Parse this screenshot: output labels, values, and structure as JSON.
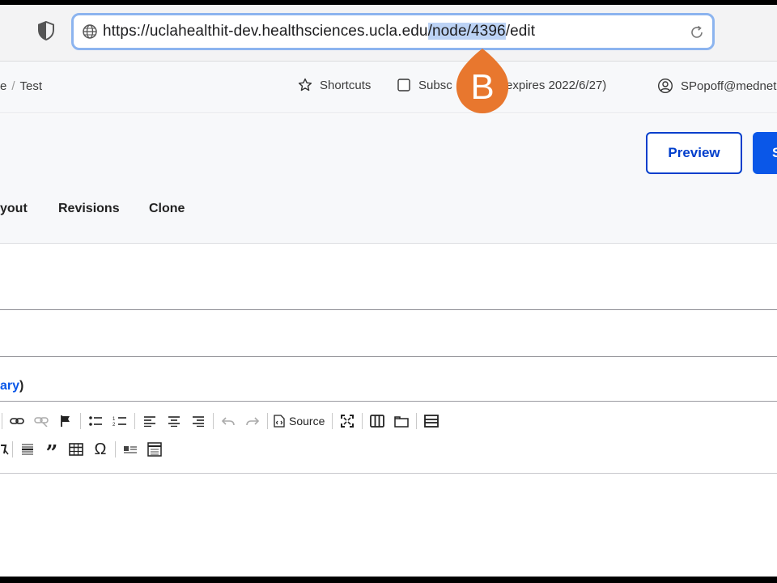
{
  "browser": {
    "url_prefix": "https://uclahealthit-dev.healthsciences.ucla.edu",
    "url_selected": "/node/4396",
    "url_suffix": "/edit"
  },
  "admin_toolbar": {
    "breadcrumb_prev": "e",
    "breadcrumb_current": "Test",
    "shortcuts_label": "Shortcuts",
    "subscribe_label_start": "Subsc",
    "subscribe_label_end": "ive (expires 2022/6/27)",
    "user_label": "SPopoff@mednet"
  },
  "badge": {
    "letter": "B",
    "color": "#e8772e"
  },
  "header": {
    "preview_label": "Preview",
    "save_label": "S",
    "tabs": [
      "yout",
      "Revisions",
      "Clone"
    ]
  },
  "form": {
    "text_format_partial": "ary",
    "text_format_close": ")"
  },
  "editor_toolbar": {
    "source_label": "Source"
  },
  "colors": {
    "accent": "#003ecc",
    "primary_button": "#0a57e8",
    "url_focus": "#8cb4ef",
    "url_selection": "#bcd3f5"
  }
}
